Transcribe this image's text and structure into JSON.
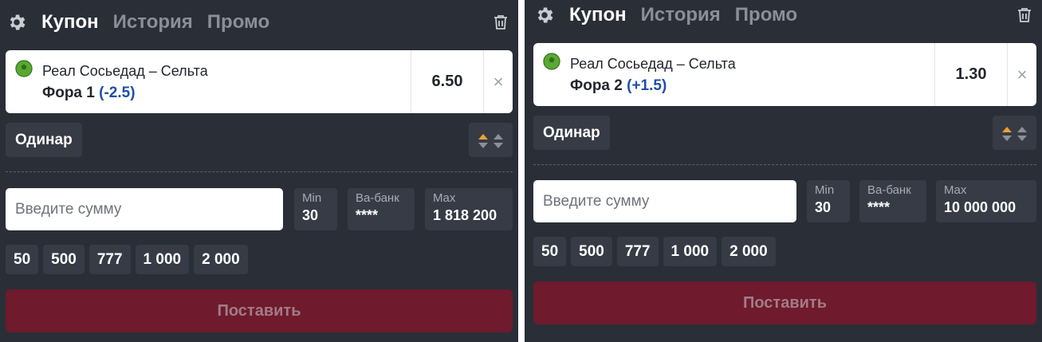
{
  "colors": {
    "panel_bg": "#2a2e37",
    "chip_bg": "#373b45",
    "place_button_bg": "#6f1a2d",
    "place_button_text": "#a27b86",
    "handicap_blue": "#1f4fa8",
    "sorter_active": "#f0a030"
  },
  "panels": [
    {
      "tabs": [
        "Купон",
        "История",
        "Промо"
      ],
      "active_tab": "Купон",
      "bet": {
        "match": "Реал Сосьедад – Сельта",
        "market_label": "Фора 1",
        "handicap": "(-2.5)",
        "odds": "6.50",
        "close": "×"
      },
      "bet_type": "Одинар",
      "amount_placeholder": "Введите сумму",
      "limits": {
        "min_label": "Min",
        "min_value": "30",
        "allin_label": "Ва-банк",
        "allin_value": "****",
        "max_label": "Max",
        "max_value": "1 818 200"
      },
      "quick_amounts": [
        "50",
        "500",
        "777",
        "1 000",
        "2 000"
      ],
      "place_label": "Поставить"
    },
    {
      "tabs": [
        "Купон",
        "История",
        "Промо"
      ],
      "active_tab": "Купон",
      "bet": {
        "match": "Реал Сосьедад – Сельта",
        "market_label": "Фора 2",
        "handicap": "(+1.5)",
        "odds": "1.30",
        "close": "×"
      },
      "bet_type": "Одинар",
      "amount_placeholder": "Введите сумму",
      "limits": {
        "min_label": "Min",
        "min_value": "30",
        "allin_label": "Ва-банк",
        "allin_value": "****",
        "max_label": "Max",
        "max_value": "10 000 000"
      },
      "quick_amounts": [
        "50",
        "500",
        "777",
        "1 000",
        "2 000"
      ],
      "place_label": "Поставить"
    }
  ],
  "icons": {
    "settings": "gear-icon",
    "delete": "trash-icon",
    "sport": "football-icon",
    "sort": "sort-arrows-icon"
  }
}
